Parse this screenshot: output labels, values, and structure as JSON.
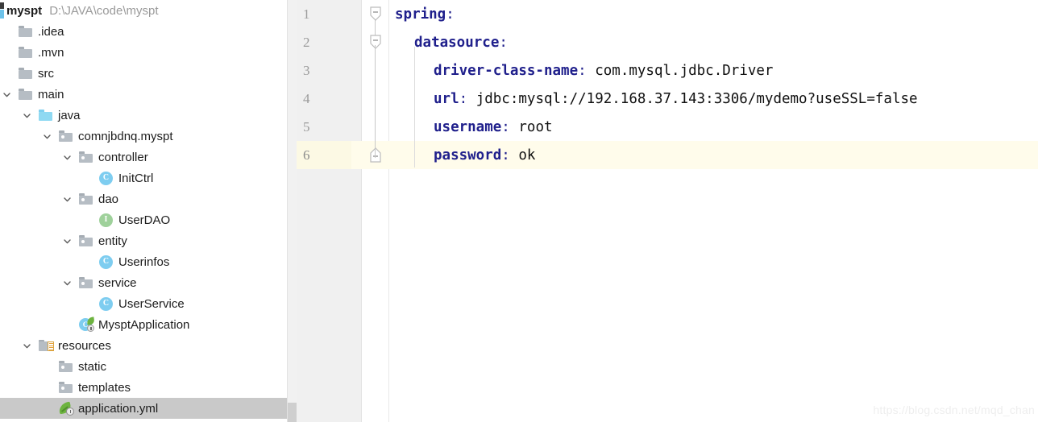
{
  "project": {
    "root": {
      "name": "myspt",
      "path": "D:\\JAVA\\code\\myspt",
      "icon": "project-module-icon"
    },
    "tree": [
      {
        "label": ".idea",
        "icon": "folder-icon",
        "depth": 1,
        "chevron": "none",
        "type": "folder",
        "selected": false
      },
      {
        "label": ".mvn",
        "icon": "folder-icon",
        "depth": 1,
        "chevron": "none",
        "type": "folder",
        "selected": false
      },
      {
        "label": "src",
        "icon": "folder-icon",
        "depth": 1,
        "chevron": "none",
        "type": "folder",
        "selected": false
      },
      {
        "label": "main",
        "icon": "folder-icon",
        "depth": 1,
        "chevron": "down",
        "type": "folder",
        "selected": false
      },
      {
        "label": "java",
        "icon": "source-folder-icon",
        "depth": 2,
        "chevron": "down",
        "type": "source",
        "selected": false
      },
      {
        "label": "comnjbdnq.myspt",
        "icon": "package-icon",
        "depth": 3,
        "chevron": "down",
        "type": "package",
        "selected": false
      },
      {
        "label": "controller",
        "icon": "package-icon",
        "depth": 4,
        "chevron": "down",
        "type": "package",
        "selected": false
      },
      {
        "label": "InitCtrl",
        "icon": "java-class-icon",
        "depth": 5,
        "chevron": "none",
        "type": "class",
        "selected": false,
        "glyph": "C"
      },
      {
        "label": "dao",
        "icon": "package-icon",
        "depth": 4,
        "chevron": "down",
        "type": "package",
        "selected": false
      },
      {
        "label": "UserDAO",
        "icon": "java-interface-icon",
        "depth": 5,
        "chevron": "none",
        "type": "interface",
        "selected": false,
        "glyph": "I"
      },
      {
        "label": "entity",
        "icon": "package-icon",
        "depth": 4,
        "chevron": "down",
        "type": "package",
        "selected": false
      },
      {
        "label": "Userinfos",
        "icon": "java-class-icon",
        "depth": 5,
        "chevron": "none",
        "type": "class",
        "selected": false,
        "glyph": "C"
      },
      {
        "label": "service",
        "icon": "package-icon",
        "depth": 4,
        "chevron": "down",
        "type": "package",
        "selected": false
      },
      {
        "label": "UserService",
        "icon": "java-class-icon",
        "depth": 5,
        "chevron": "none",
        "type": "class",
        "selected": false,
        "glyph": "C"
      },
      {
        "label": "MysptApplication",
        "icon": "spring-boot-app-icon",
        "depth": 4,
        "chevron": "none",
        "type": "springapp",
        "selected": false,
        "glyph": "C"
      },
      {
        "label": "resources",
        "icon": "resources-folder-icon",
        "depth": 2,
        "chevron": "down",
        "type": "resources",
        "selected": false
      },
      {
        "label": "static",
        "icon": "package-icon",
        "depth": 3,
        "chevron": "none",
        "type": "package",
        "selected": false
      },
      {
        "label": "templates",
        "icon": "package-icon",
        "depth": 3,
        "chevron": "none",
        "type": "package",
        "selected": false
      },
      {
        "label": "application.yml",
        "icon": "spring-yaml-icon",
        "depth": 3,
        "chevron": "none",
        "type": "yml",
        "selected": true
      }
    ]
  },
  "editor": {
    "file": "application.yml",
    "language": "yaml",
    "current_line": 6,
    "lines": [
      {
        "num": "1",
        "indent": 0,
        "key": "spring",
        "colon": ":",
        "value": "",
        "fold": "collapse-down",
        "current": false
      },
      {
        "num": "2",
        "indent": 1,
        "key": "datasource",
        "colon": ":",
        "value": "",
        "fold": "collapse-down",
        "current": false
      },
      {
        "num": "3",
        "indent": 2,
        "key": "driver-class-name",
        "colon": ":",
        "value": "com.mysql.jdbc.Driver",
        "fold": "none",
        "current": false
      },
      {
        "num": "4",
        "indent": 2,
        "key": "url",
        "colon": ":",
        "value": "jdbc:mysql://192.168.37.143:3306/mydemo?useSSL=false",
        "fold": "none",
        "current": false
      },
      {
        "num": "5",
        "indent": 2,
        "key": "username",
        "colon": ":",
        "value": "root",
        "fold": "none",
        "current": false
      },
      {
        "num": "6",
        "indent": 2,
        "key": "password",
        "colon": ":",
        "value": "ok",
        "fold": "collapse-up",
        "current": true
      }
    ]
  },
  "watermark": {
    "text": "https://blog.csdn.net/mqd_chan"
  },
  "colors": {
    "yaml_key": "#20208c",
    "yaml_value": "#111111",
    "current_line_bg": "#fffceb",
    "selection_bg": "#c9c9c9",
    "gutter_bg": "#f0f0f0",
    "source_folder": "#8fd9f2",
    "class_glyph": "#7ecdf0",
    "interface_glyph": "#9fd19b",
    "spring_green": "#6db33f"
  }
}
